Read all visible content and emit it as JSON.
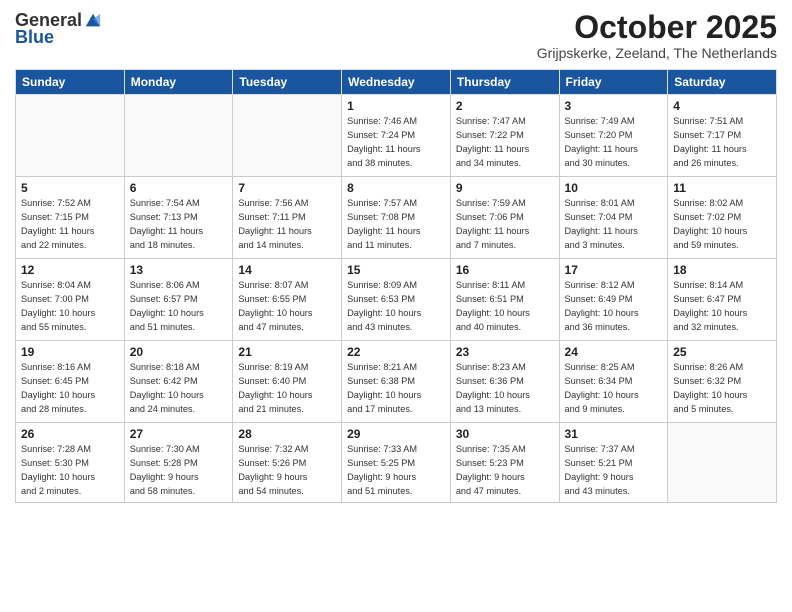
{
  "logo": {
    "general": "General",
    "blue": "Blue"
  },
  "header": {
    "month": "October 2025",
    "location": "Grijpskerke, Zeeland, The Netherlands"
  },
  "weekdays": [
    "Sunday",
    "Monday",
    "Tuesday",
    "Wednesday",
    "Thursday",
    "Friday",
    "Saturday"
  ],
  "weeks": [
    [
      {
        "day": "",
        "info": ""
      },
      {
        "day": "",
        "info": ""
      },
      {
        "day": "",
        "info": ""
      },
      {
        "day": "1",
        "info": "Sunrise: 7:46 AM\nSunset: 7:24 PM\nDaylight: 11 hours\nand 38 minutes."
      },
      {
        "day": "2",
        "info": "Sunrise: 7:47 AM\nSunset: 7:22 PM\nDaylight: 11 hours\nand 34 minutes."
      },
      {
        "day": "3",
        "info": "Sunrise: 7:49 AM\nSunset: 7:20 PM\nDaylight: 11 hours\nand 30 minutes."
      },
      {
        "day": "4",
        "info": "Sunrise: 7:51 AM\nSunset: 7:17 PM\nDaylight: 11 hours\nand 26 minutes."
      }
    ],
    [
      {
        "day": "5",
        "info": "Sunrise: 7:52 AM\nSunset: 7:15 PM\nDaylight: 11 hours\nand 22 minutes."
      },
      {
        "day": "6",
        "info": "Sunrise: 7:54 AM\nSunset: 7:13 PM\nDaylight: 11 hours\nand 18 minutes."
      },
      {
        "day": "7",
        "info": "Sunrise: 7:56 AM\nSunset: 7:11 PM\nDaylight: 11 hours\nand 14 minutes."
      },
      {
        "day": "8",
        "info": "Sunrise: 7:57 AM\nSunset: 7:08 PM\nDaylight: 11 hours\nand 11 minutes."
      },
      {
        "day": "9",
        "info": "Sunrise: 7:59 AM\nSunset: 7:06 PM\nDaylight: 11 hours\nand 7 minutes."
      },
      {
        "day": "10",
        "info": "Sunrise: 8:01 AM\nSunset: 7:04 PM\nDaylight: 11 hours\nand 3 minutes."
      },
      {
        "day": "11",
        "info": "Sunrise: 8:02 AM\nSunset: 7:02 PM\nDaylight: 10 hours\nand 59 minutes."
      }
    ],
    [
      {
        "day": "12",
        "info": "Sunrise: 8:04 AM\nSunset: 7:00 PM\nDaylight: 10 hours\nand 55 minutes."
      },
      {
        "day": "13",
        "info": "Sunrise: 8:06 AM\nSunset: 6:57 PM\nDaylight: 10 hours\nand 51 minutes."
      },
      {
        "day": "14",
        "info": "Sunrise: 8:07 AM\nSunset: 6:55 PM\nDaylight: 10 hours\nand 47 minutes."
      },
      {
        "day": "15",
        "info": "Sunrise: 8:09 AM\nSunset: 6:53 PM\nDaylight: 10 hours\nand 43 minutes."
      },
      {
        "day": "16",
        "info": "Sunrise: 8:11 AM\nSunset: 6:51 PM\nDaylight: 10 hours\nand 40 minutes."
      },
      {
        "day": "17",
        "info": "Sunrise: 8:12 AM\nSunset: 6:49 PM\nDaylight: 10 hours\nand 36 minutes."
      },
      {
        "day": "18",
        "info": "Sunrise: 8:14 AM\nSunset: 6:47 PM\nDaylight: 10 hours\nand 32 minutes."
      }
    ],
    [
      {
        "day": "19",
        "info": "Sunrise: 8:16 AM\nSunset: 6:45 PM\nDaylight: 10 hours\nand 28 minutes."
      },
      {
        "day": "20",
        "info": "Sunrise: 8:18 AM\nSunset: 6:42 PM\nDaylight: 10 hours\nand 24 minutes."
      },
      {
        "day": "21",
        "info": "Sunrise: 8:19 AM\nSunset: 6:40 PM\nDaylight: 10 hours\nand 21 minutes."
      },
      {
        "day": "22",
        "info": "Sunrise: 8:21 AM\nSunset: 6:38 PM\nDaylight: 10 hours\nand 17 minutes."
      },
      {
        "day": "23",
        "info": "Sunrise: 8:23 AM\nSunset: 6:36 PM\nDaylight: 10 hours\nand 13 minutes."
      },
      {
        "day": "24",
        "info": "Sunrise: 8:25 AM\nSunset: 6:34 PM\nDaylight: 10 hours\nand 9 minutes."
      },
      {
        "day": "25",
        "info": "Sunrise: 8:26 AM\nSunset: 6:32 PM\nDaylight: 10 hours\nand 5 minutes."
      }
    ],
    [
      {
        "day": "26",
        "info": "Sunrise: 7:28 AM\nSunset: 5:30 PM\nDaylight: 10 hours\nand 2 minutes."
      },
      {
        "day": "27",
        "info": "Sunrise: 7:30 AM\nSunset: 5:28 PM\nDaylight: 9 hours\nand 58 minutes."
      },
      {
        "day": "28",
        "info": "Sunrise: 7:32 AM\nSunset: 5:26 PM\nDaylight: 9 hours\nand 54 minutes."
      },
      {
        "day": "29",
        "info": "Sunrise: 7:33 AM\nSunset: 5:25 PM\nDaylight: 9 hours\nand 51 minutes."
      },
      {
        "day": "30",
        "info": "Sunrise: 7:35 AM\nSunset: 5:23 PM\nDaylight: 9 hours\nand 47 minutes."
      },
      {
        "day": "31",
        "info": "Sunrise: 7:37 AM\nSunset: 5:21 PM\nDaylight: 9 hours\nand 43 minutes."
      },
      {
        "day": "",
        "info": ""
      }
    ]
  ]
}
